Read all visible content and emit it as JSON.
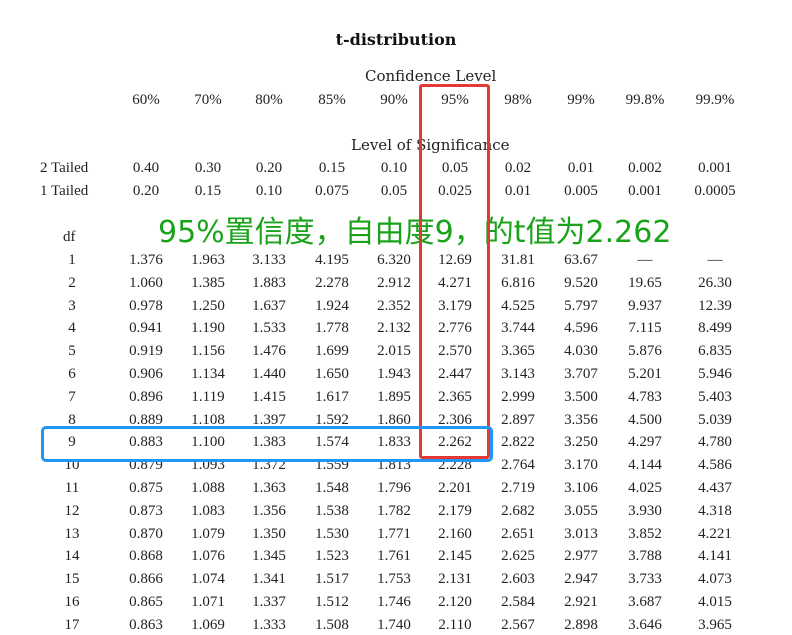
{
  "title": "t-distribution",
  "confidence_caption": "Confidence Level",
  "significance_caption": "Level of Significance",
  "confidence_levels": [
    "60%",
    "70%",
    "80%",
    "85%",
    "90%",
    "95%",
    "98%",
    "99%",
    "99.8%",
    "99.9%"
  ],
  "two_tailed": {
    "label": "2 Tailed",
    "values": [
      "0.40",
      "0.30",
      "0.20",
      "0.15",
      "0.10",
      "0.05",
      "0.02",
      "0.01",
      "0.002",
      "0.001"
    ]
  },
  "one_tailed": {
    "label": "1 Tailed",
    "values": [
      "0.20",
      "0.15",
      "0.10",
      "0.075",
      "0.05",
      "0.025",
      "0.01",
      "0.005",
      "0.001",
      "0.0005"
    ]
  },
  "df_header": "df",
  "annotation": "95%置信度，自由度9，的t值为2.262",
  "rows": [
    {
      "df": "1",
      "values": [
        "1.376",
        "1.963",
        "3.133",
        "4.195",
        "6.320",
        "12.69",
        "31.81",
        "63.67",
        "—",
        "—"
      ]
    },
    {
      "df": "2",
      "values": [
        "1.060",
        "1.385",
        "1.883",
        "2.278",
        "2.912",
        "4.271",
        "6.816",
        "9.520",
        "19.65",
        "26.30"
      ]
    },
    {
      "df": "3",
      "values": [
        "0.978",
        "1.250",
        "1.637",
        "1.924",
        "2.352",
        "3.179",
        "4.525",
        "5.797",
        "9.937",
        "12.39"
      ]
    },
    {
      "df": "4",
      "values": [
        "0.941",
        "1.190",
        "1.533",
        "1.778",
        "2.132",
        "2.776",
        "3.744",
        "4.596",
        "7.115",
        "8.499"
      ]
    },
    {
      "df": "5",
      "values": [
        "0.919",
        "1.156",
        "1.476",
        "1.699",
        "2.015",
        "2.570",
        "3.365",
        "4.030",
        "5.876",
        "6.835"
      ]
    },
    {
      "df": "6",
      "values": [
        "0.906",
        "1.134",
        "1.440",
        "1.650",
        "1.943",
        "2.447",
        "3.143",
        "3.707",
        "5.201",
        "5.946"
      ]
    },
    {
      "df": "7",
      "values": [
        "0.896",
        "1.119",
        "1.415",
        "1.617",
        "1.895",
        "2.365",
        "2.999",
        "3.500",
        "4.783",
        "5.403"
      ]
    },
    {
      "df": "8",
      "values": [
        "0.889",
        "1.108",
        "1.397",
        "1.592",
        "1.860",
        "2.306",
        "2.897",
        "3.356",
        "4.500",
        "5.039"
      ]
    },
    {
      "df": "9",
      "values": [
        "0.883",
        "1.100",
        "1.383",
        "1.574",
        "1.833",
        "2.262",
        "2.822",
        "3.250",
        "4.297",
        "4.780"
      ]
    },
    {
      "df": "10",
      "values": [
        "0.879",
        "1.093",
        "1.372",
        "1.559",
        "1.813",
        "2.228",
        "2.764",
        "3.170",
        "4.144",
        "4.586"
      ]
    },
    {
      "df": "11",
      "values": [
        "0.875",
        "1.088",
        "1.363",
        "1.548",
        "1.796",
        "2.201",
        "2.719",
        "3.106",
        "4.025",
        "4.437"
      ]
    },
    {
      "df": "12",
      "values": [
        "0.873",
        "1.083",
        "1.356",
        "1.538",
        "1.782",
        "2.179",
        "2.682",
        "3.055",
        "3.930",
        "4.318"
      ]
    },
    {
      "df": "13",
      "values": [
        "0.870",
        "1.079",
        "1.350",
        "1.530",
        "1.771",
        "2.160",
        "2.651",
        "3.013",
        "3.852",
        "4.221"
      ]
    },
    {
      "df": "14",
      "values": [
        "0.868",
        "1.076",
        "1.345",
        "1.523",
        "1.761",
        "2.145",
        "2.625",
        "2.977",
        "3.788",
        "4.141"
      ]
    },
    {
      "df": "15",
      "values": [
        "0.866",
        "1.074",
        "1.341",
        "1.517",
        "1.753",
        "2.131",
        "2.603",
        "2.947",
        "3.733",
        "4.073"
      ]
    },
    {
      "df": "16",
      "values": [
        "0.865",
        "1.071",
        "1.337",
        "1.512",
        "1.746",
        "2.120",
        "2.584",
        "2.921",
        "3.687",
        "4.015"
      ]
    },
    {
      "df": "17",
      "values": [
        "0.863",
        "1.069",
        "1.333",
        "1.508",
        "1.740",
        "2.110",
        "2.567",
        "2.898",
        "3.646",
        "3.965"
      ]
    }
  ],
  "colors": {
    "annotation": "#1aa31a",
    "highlight_column": "#e53935",
    "highlight_row": "#2196f3"
  }
}
